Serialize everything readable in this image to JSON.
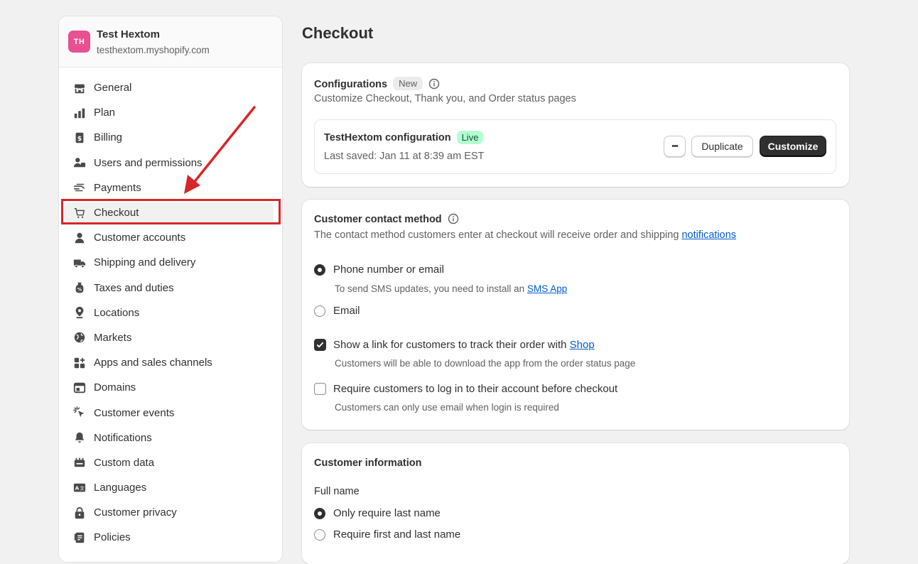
{
  "store": {
    "initials": "TH",
    "name": "Test Hextom",
    "domain": "testhextom.myshopify.com",
    "avatar_color": "#e8508f"
  },
  "sidebar": {
    "items": [
      {
        "label": "General",
        "icon": "store-icon"
      },
      {
        "label": "Plan",
        "icon": "plan-icon"
      },
      {
        "label": "Billing",
        "icon": "billing-icon"
      },
      {
        "label": "Users and permissions",
        "icon": "users-icon"
      },
      {
        "label": "Payments",
        "icon": "payments-icon"
      },
      {
        "label": "Checkout",
        "icon": "cart-icon",
        "active": true
      },
      {
        "label": "Customer accounts",
        "icon": "person-icon"
      },
      {
        "label": "Shipping and delivery",
        "icon": "truck-icon"
      },
      {
        "label": "Taxes and duties",
        "icon": "taxes-icon"
      },
      {
        "label": "Locations",
        "icon": "location-icon"
      },
      {
        "label": "Markets",
        "icon": "globe-icon"
      },
      {
        "label": "Apps and sales channels",
        "icon": "apps-icon"
      },
      {
        "label": "Domains",
        "icon": "domains-icon"
      },
      {
        "label": "Customer events",
        "icon": "cursor-icon"
      },
      {
        "label": "Notifications",
        "icon": "bell-icon"
      },
      {
        "label": "Custom data",
        "icon": "custom-data-icon"
      },
      {
        "label": "Languages",
        "icon": "language-icon"
      },
      {
        "label": "Customer privacy",
        "icon": "lock-icon"
      },
      {
        "label": "Policies",
        "icon": "policies-icon"
      }
    ]
  },
  "page": {
    "title": "Checkout"
  },
  "configurations": {
    "title": "Configurations",
    "badge": "New",
    "subtitle": "Customize Checkout, Thank you, and Order status pages",
    "config_name": "TestHextom configuration",
    "status": "Live",
    "last_saved": "Last saved: Jan 11 at 8:39 am EST",
    "more_label": "•••",
    "duplicate_label": "Duplicate",
    "customize_label": "Customize"
  },
  "contact": {
    "title": "Customer contact method",
    "description": "The contact method customers enter at checkout will receive order and shipping ",
    "description_link": "notifications",
    "option_phone": "Phone number or email",
    "phone_helper": "To send SMS updates, you need to install an ",
    "phone_helper_link": "SMS App",
    "option_email": "Email",
    "shop_link_label": "Show a link for customers to track their order with ",
    "shop_link_link": "Shop",
    "shop_helper": "Customers will be able to download the app from the order status page",
    "require_login_label": "Require customers to log in to their account before checkout",
    "require_login_helper": "Customers can only use email when login is required"
  },
  "customer_info": {
    "title": "Customer information",
    "full_name_label": "Full name",
    "option_last": "Only require last name",
    "option_first_last": "Require first and last name"
  },
  "colors": {
    "annotation": "#d7262b",
    "link": "#005bd3",
    "primary_button": "#303030",
    "live_badge": "#b4fed2"
  }
}
